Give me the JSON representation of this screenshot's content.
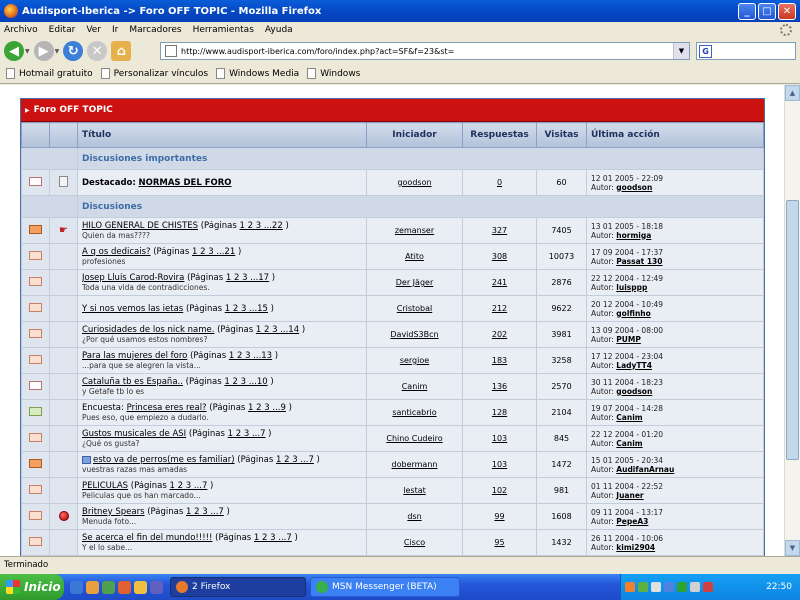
{
  "window": {
    "title": "Audisport-Iberica -> Foro OFF TOPIC - Mozilla Firefox",
    "buttons": {
      "minimize": "_",
      "maximize": "□",
      "close": "✕"
    }
  },
  "menu": [
    "Archivo",
    "Editar",
    "Ver",
    "Ir",
    "Marcadores",
    "Herramientas",
    "Ayuda"
  ],
  "address": {
    "url": "http://www.audisport-iberica.com/foro/index.php?act=SF&f=23&st="
  },
  "bookmarks": [
    "Hotmail gratuito",
    "Personalizar vínculos",
    "Windows Media",
    "Windows"
  ],
  "forum": {
    "title": "Foro OFF TOPIC",
    "columns": [
      "Título",
      "Iniciador",
      "Respuestas",
      "Visitas",
      "Última acción"
    ],
    "section_important": "Discusiones importantes",
    "section_discussions": "Discusiones",
    "pinned": {
      "prefix": "Destacado:",
      "title": "NORMAS DEL FORO",
      "starter": "goodson",
      "replies": "0",
      "views": "60",
      "last_date": "12 01 2005 - 22:09",
      "last_author_label": "Autor:",
      "last_author": "goodson"
    },
    "pages_label": "(Páginas",
    "author_label": "Autor:",
    "topics": [
      {
        "icon": "hot",
        "mark": "hand",
        "title": "HILO GENERAL DE CHISTES",
        "pages": "1 2 3 ...22",
        "desc": "Quien da mas????",
        "starter": "zemanser",
        "replies": "327",
        "views": "7405",
        "date": "13 01 2005 - 18:18",
        "author": "hormiga"
      },
      {
        "icon": "normal",
        "mark": "",
        "title": "A q os dedicais?",
        "pages": "1 2 3 ...21",
        "desc": "profesiones",
        "starter": "Atito",
        "replies": "308",
        "views": "10073",
        "date": "17 09 2004 - 17:37",
        "author": "Passat 130"
      },
      {
        "icon": "normal",
        "mark": "",
        "title": "Josep Lluís Carod-Rovira",
        "pages": "1 2 3 ...17",
        "desc": "Toda una vida de contradicciones.",
        "starter": "Der Jäger",
        "replies": "241",
        "views": "2876",
        "date": "22 12 2004 - 12:49",
        "author": "luisppp"
      },
      {
        "icon": "normal",
        "mark": "",
        "title": "Y si nos vemos las ietas",
        "pages": "1 2 3 ...15",
        "desc": "",
        "starter": "Cristobal",
        "replies": "212",
        "views": "9622",
        "date": "20 12 2004 - 10:49",
        "author": "golfinho"
      },
      {
        "icon": "normal",
        "mark": "",
        "title": "Curiosidades de los nick name.",
        "pages": "1 2 3 ...14",
        "desc": "¿Por qué usamos estos nombres?",
        "starter": "DavidS3Bcn",
        "replies": "202",
        "views": "3981",
        "date": "13 09 2004 - 08:00",
        "author": "PUMP"
      },
      {
        "icon": "normal",
        "mark": "",
        "title": "Para las mujeres del foro",
        "pages": "1 2 3 ...13",
        "desc": "...para que se alegren la vista...",
        "starter": "sergioe",
        "replies": "183",
        "views": "3258",
        "date": "17 12 2004 - 23:04",
        "author": "LadyTT4"
      },
      {
        "icon": "pinned",
        "mark": "",
        "title": "Cataluña tb es España..",
        "pages": "1 2 3 ...10",
        "desc": "y Getafe tb lo es",
        "starter": "Canim",
        "replies": "136",
        "views": "2570",
        "date": "30 11 2004 - 18:23",
        "author": "goodson"
      },
      {
        "icon": "poll",
        "mark": "",
        "prefix": "Encuesta:",
        "title": "Princesa eres real?",
        "pages": "1 2 3 ...9",
        "desc": "Pues eso, que empiezo a dudarlo.",
        "starter": "santicabrio",
        "replies": "128",
        "views": "2104",
        "date": "19 07 2004 - 14:28",
        "author": "Canim"
      },
      {
        "icon": "normal",
        "mark": "",
        "title": "Gustos musicales de ASI",
        "pages": "1 2 3 ...7",
        "desc": "¿Qué os gusta?",
        "starter": "Chino Cudeiro",
        "replies": "103",
        "views": "845",
        "date": "22 12 2004 - 01:20",
        "author": "Canim"
      },
      {
        "icon": "hot",
        "mark": "",
        "title": "esto va de perros(me es familiar)",
        "pages": "1 2 3 ...7",
        "desc": "vuestras razas mas amadas",
        "starter": "dobermann",
        "replies": "103",
        "views": "1472",
        "date": "15 01 2005 - 20:34",
        "author": "AudifanArnau",
        "mini": true
      },
      {
        "icon": "normal",
        "mark": "",
        "title": "PELICULAS",
        "pages": "1 2 3 ...7",
        "desc": "Peliculas que os han marcado...",
        "starter": "lestat",
        "replies": "102",
        "views": "981",
        "date": "01 11 2004 - 22:52",
        "author": "Juaner"
      },
      {
        "icon": "normal",
        "mark": "redball",
        "title": "Britney Spears",
        "pages": "1 2 3 ...7",
        "desc": "Menuda foto...",
        "starter": "dsn",
        "replies": "99",
        "views": "1608",
        "date": "09 11 2004 - 13:17",
        "author": "PepeA3"
      },
      {
        "icon": "normal",
        "mark": "",
        "title": "Se acerca el fin del mundo!!!!!",
        "pages": "1 2 3 ...7",
        "desc": "Y el lo sabe...",
        "starter": "Cisco",
        "replies": "95",
        "views": "1432",
        "date": "26 11 2004 - 10:06",
        "author": "kimi2904"
      }
    ]
  },
  "status": "Terminado",
  "taskbar": {
    "start": "Inicio",
    "tasks": [
      "2 Firefox",
      "MSN Messenger (BETA)"
    ],
    "clock": "22:50"
  }
}
